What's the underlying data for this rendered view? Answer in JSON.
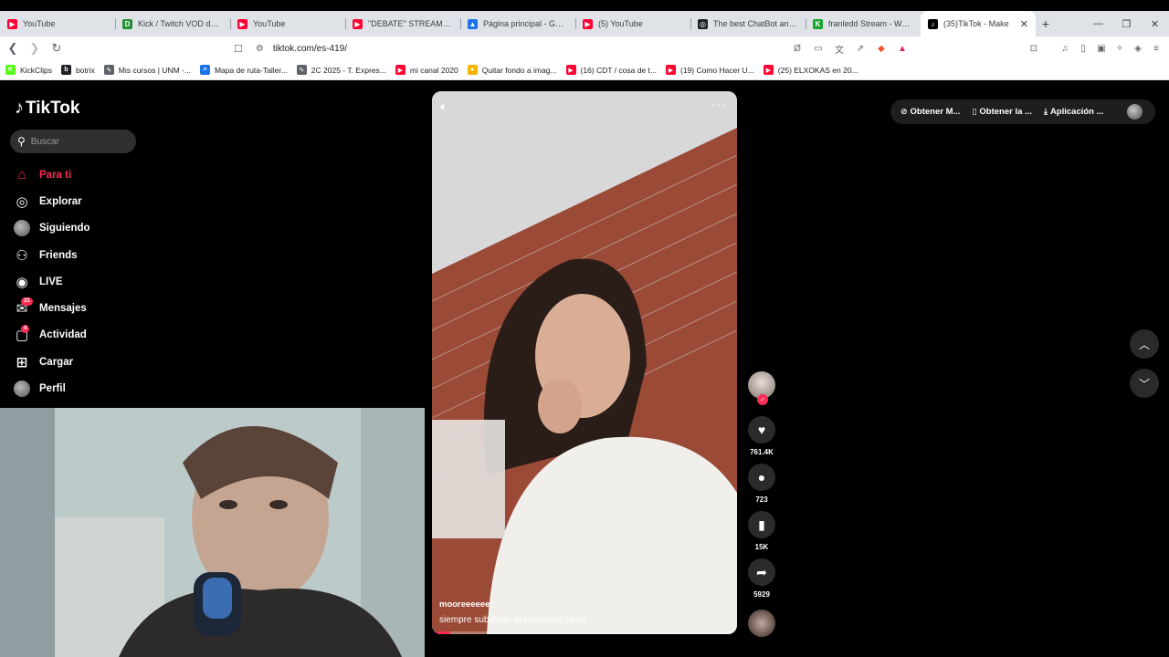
{
  "browser": {
    "tabs": [
      {
        "title": "YouTube",
        "color": "#ff0033",
        "glyph": "▶"
      },
      {
        "title": "Kick / Twitch VOD downlo",
        "color": "#1f8f2f",
        "glyph": "D"
      },
      {
        "title": "YouTube",
        "color": "#ff0033",
        "glyph": "▶"
      },
      {
        "title": "\"DEBATE\" STREAMERS UN",
        "color": "#ff0033",
        "glyph": "▶"
      },
      {
        "title": "Página principal - Google",
        "color": "#1a73e8",
        "glyph": "▲"
      },
      {
        "title": "(5) YouTube",
        "color": "#ff0033",
        "glyph": "▶"
      },
      {
        "title": "The best ChatBot and Wi",
        "color": "#202124",
        "glyph": "◎"
      },
      {
        "title": "franledd Stream - Watch",
        "color": "#18a52b",
        "glyph": "K"
      },
      {
        "title": "(35)TikTok - Make",
        "color": "#000000",
        "glyph": "♪",
        "active": true
      }
    ],
    "url": "tiktok.com/es-419/",
    "bookmarks": [
      {
        "label": "KickClips",
        "color": "#53fc18",
        "glyph": "K"
      },
      {
        "label": "botrix",
        "color": "#202124",
        "glyph": "b"
      },
      {
        "label": "Mis cursos | UNM -...",
        "color": "#5f6368",
        "glyph": "✎"
      },
      {
        "label": "Mapa de ruta-Taller...",
        "color": "#1a73e8",
        "glyph": "≡"
      },
      {
        "label": "2C 2025 - T. Expres...",
        "color": "#5f6368",
        "glyph": "✎"
      },
      {
        "label": "mi canal 2020",
        "color": "#ff0033",
        "glyph": "▶"
      },
      {
        "label": "Quitar fondo a imag...",
        "color": "#f4b400",
        "glyph": "●"
      },
      {
        "label": "(16) CDT / cosa de t...",
        "color": "#ff0033",
        "glyph": "▶"
      },
      {
        "label": "(19) Como Hacer U...",
        "color": "#ff0033",
        "glyph": "▶"
      },
      {
        "label": "(25) ELXOKAS en 20...",
        "color": "#ff0033",
        "glyph": "▶"
      }
    ]
  },
  "tiktok": {
    "logo": "TikTok",
    "search_placeholder": "Buscar",
    "nav": [
      {
        "label": "Para ti",
        "icon": "home-icon",
        "active": true
      },
      {
        "label": "Explorar",
        "icon": "compass-icon"
      },
      {
        "label": "Siguiendo",
        "icon": "following-avatar-icon"
      },
      {
        "label": "Friends",
        "icon": "friends-icon"
      },
      {
        "label": "LIVE",
        "icon": "live-icon"
      },
      {
        "label": "Mensajes",
        "icon": "messages-icon",
        "badge": "31"
      },
      {
        "label": "Actividad",
        "icon": "activity-icon",
        "badge": "4"
      },
      {
        "label": "Cargar",
        "icon": "upload-icon"
      },
      {
        "label": "Perfil",
        "icon": "profile-avatar-icon"
      }
    ],
    "top_right": {
      "coins_label": "Obtener M...",
      "app_label": "Obtener la ...",
      "download_label": "Aplicación ..."
    },
    "video": {
      "username": "mooreeeeee_",
      "caption": "siempre subiendo el contenido tarde",
      "progress": 0.06
    },
    "actions": {
      "likes": "761.4K",
      "comments": "723",
      "saves": "15K",
      "shares": "5929"
    }
  }
}
